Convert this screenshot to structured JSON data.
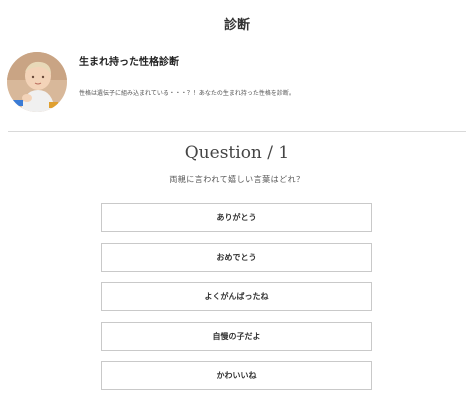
{
  "header": {
    "title": "診断"
  },
  "diagnosis": {
    "avatar_icon": "baby-photo",
    "title": "生まれ持った性格診断",
    "description": "性格は遺伝子に組み込まれている・・・？！あなたの生まれ持った性格を診断。"
  },
  "question": {
    "heading": "Question / 1",
    "text": "両親に言われて嬉しい言葉はどれ？",
    "options": [
      {
        "label": "ありがとう"
      },
      {
        "label": "おめでとう"
      },
      {
        "label": "よくがんばったね"
      },
      {
        "label": "自慢の子だよ"
      },
      {
        "label": "かわいいね"
      }
    ]
  }
}
